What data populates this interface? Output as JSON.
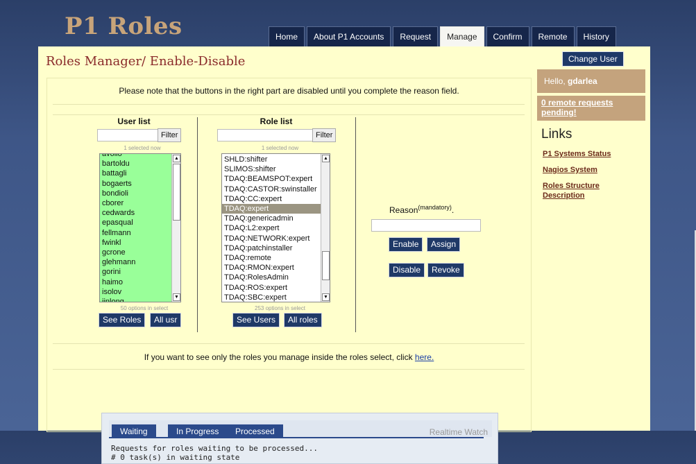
{
  "brand": "P1 Roles",
  "nav": [
    "Home",
    "About P1 Accounts",
    "Request",
    "Manage",
    "Confirm",
    "Remote",
    "History"
  ],
  "nav_active": "Manage",
  "title": "Roles Manager/ Enable-Disable",
  "note": "Please note that the buttons in the right part are disabled until you complete the reason field.",
  "user_list": {
    "title": "User list",
    "filter_label": "Filter",
    "selected_text": "1 selected now",
    "items": [
      "avollo",
      "bartoldu",
      "battagli",
      "bogaerts",
      "bondioli",
      "cborer",
      "cedwards",
      "epasqual",
      "fellmann",
      "fwinkl",
      "gcrone",
      "glehmann",
      "gorini",
      "haimo",
      "isolov",
      "jinlong"
    ],
    "count_text": "50 options in select",
    "see_btn": "See Roles",
    "all_btn": "All usr"
  },
  "role_list": {
    "title": "Role list",
    "filter_label": "Filter",
    "selected_text": "1 selected now",
    "items": [
      "SHLD:shifter",
      "SLIMOS:shifter",
      "TDAQ:BEAMSPOT:expert",
      "TDAQ:CASTOR:swinstaller",
      "TDAQ:CC:expert",
      "TDAQ:expert",
      "TDAQ:genericadmin",
      "TDAQ:L2:expert",
      "TDAQ:NETWORK:expert",
      "TDAQ:patchinstaller",
      "TDAQ:remote",
      "TDAQ:RMON:expert",
      "TDAQ:RolesAdmin",
      "TDAQ:ROS:expert",
      "TDAQ:SBC:expert"
    ],
    "selected_item": "TDAQ:expert",
    "count_text": "253 options in select",
    "see_btn": "See Users",
    "all_btn": "All roles"
  },
  "reason": {
    "label": "Reason",
    "sup": "(mandatory)",
    "suffix": "."
  },
  "actions": {
    "enable": "Enable",
    "assign": "Assign",
    "disable": "Disable",
    "revoke": "Revoke"
  },
  "manage_note": {
    "text": "If you want to see only the roles you manage inside the roles select, click ",
    "link": "here."
  },
  "watch": {
    "tabs": [
      "Waiting",
      "In Progress",
      "Processed"
    ],
    "label": "Realtime Watch",
    "line1": "Requests for roles waiting to be processed...",
    "line2": "# 0 task(s) in waiting state"
  },
  "side": {
    "change_user": "Change User",
    "hello_prefix": "Hello, ",
    "user": "gdarlea",
    "pending": "0 remote requests pending!",
    "links_title": "Links",
    "links": [
      "P1 Systems Status",
      "Nagios System",
      "Roles Structure Description"
    ]
  }
}
